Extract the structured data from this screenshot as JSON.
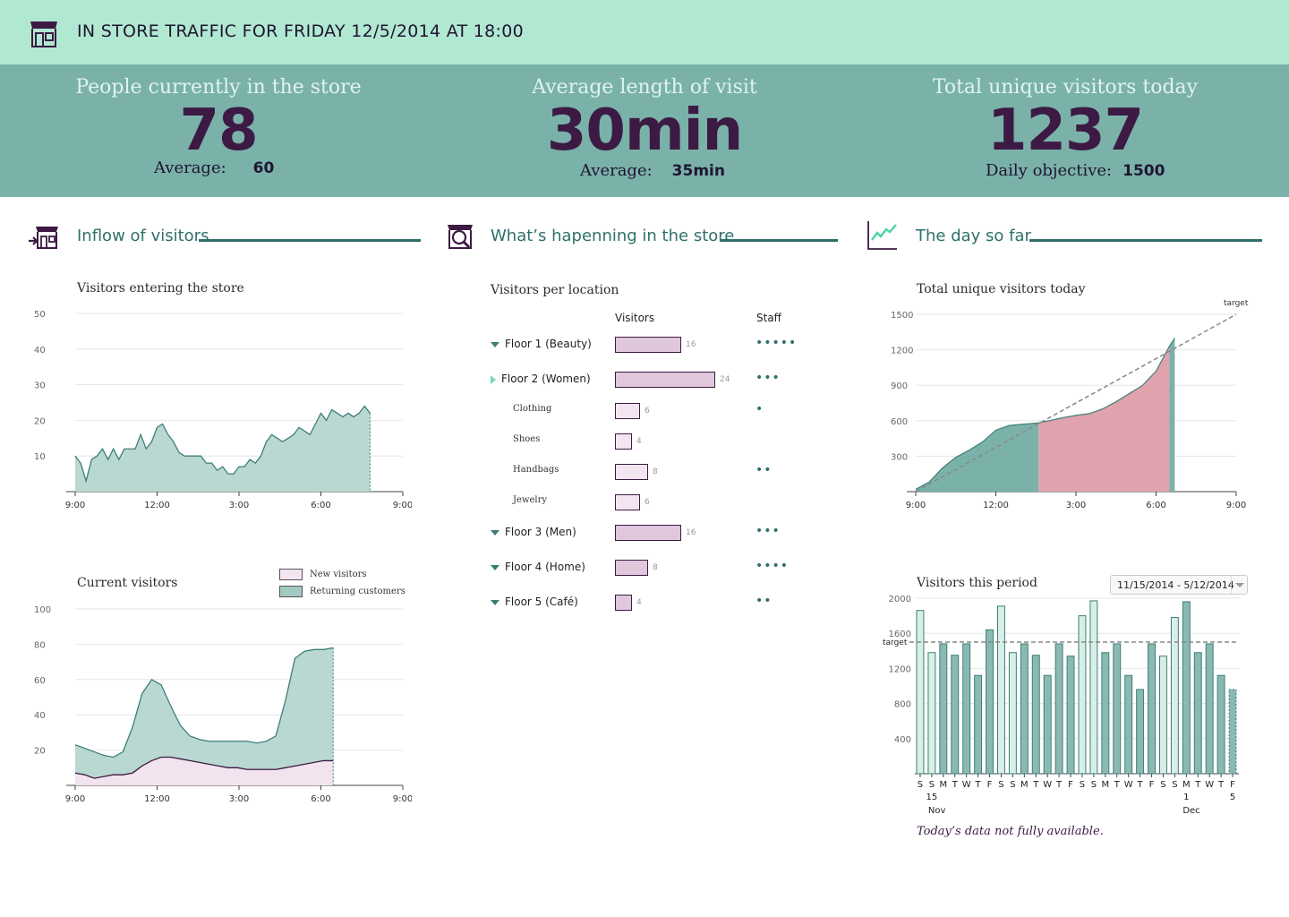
{
  "header": {
    "title": "IN STORE TRAFFIC FOR FRIDAY 12/5/2014 AT 18:00"
  },
  "kpis": [
    {
      "label": "People currently in the store",
      "value": "78",
      "sub_label": "Average:",
      "sub_value": "60"
    },
    {
      "label": "Average length of visit",
      "value": "30min",
      "sub_label": "Average:",
      "sub_value": "35min"
    },
    {
      "label": "Total unique visitors today",
      "value": "1237",
      "sub_label": "Daily objective:",
      "sub_value": "1500"
    }
  ],
  "sections": {
    "inflow": {
      "title": "Inflow of visitors"
    },
    "store": {
      "title": "What’s hapenning in the store"
    },
    "day": {
      "title": "The day so far"
    }
  },
  "locations": {
    "title": "Visitors per location",
    "col_visitors": "Visitors",
    "col_staff": "Staff",
    "rows": [
      {
        "label": "Floor 1 (Beauty)",
        "visitors": 16,
        "visitors_label": "16",
        "staff": 5,
        "level": "floor",
        "expanded": true
      },
      {
        "label": "Floor 2 (Women)",
        "visitors": 24,
        "visitors_label": "24",
        "staff": 3,
        "level": "floor",
        "expanded": false
      },
      {
        "label": "Clothing",
        "visitors": 6,
        "visitors_label": "6",
        "staff": 1,
        "level": "sub"
      },
      {
        "label": "Shoes",
        "visitors": 4,
        "visitors_label": "4",
        "staff": 0,
        "level": "sub"
      },
      {
        "label": "Handbags",
        "visitors": 8,
        "visitors_label": "8",
        "staff": 2,
        "level": "sub"
      },
      {
        "label": "Jewelry",
        "visitors": 6,
        "visitors_label": "6",
        "staff": 0,
        "level": "sub"
      },
      {
        "label": "Floor 3 (Men)",
        "visitors": 16,
        "visitors_label": "16",
        "staff": 3,
        "level": "floor",
        "expanded": true
      },
      {
        "label": "Floor 4 (Home)",
        "visitors": 8,
        "visitors_label": "8",
        "staff": 4,
        "level": "floor",
        "expanded": true
      },
      {
        "label": "Floor 5 (Café)",
        "visitors": 4,
        "visitors_label": "4",
        "staff": 2,
        "level": "floor",
        "expanded": true
      }
    ]
  },
  "period": {
    "date_range": "11/15/2014 - 5/12/2014",
    "note": "Today’s data not fully available."
  },
  "colors": {
    "teal": "#7ab2aa",
    "mint": "#b1e8d2",
    "plum": "#3c1a44",
    "pink": "#e0a3ad",
    "lilac": "#dfc7dc"
  },
  "chart_data": [
    {
      "type": "area",
      "title": "Visitors entering the store",
      "xlabel": "",
      "ylabel": "",
      "x_ticks": [
        "9:00",
        "12:00",
        "3:00",
        "6:00",
        "9:00"
      ],
      "y_ticks": [
        10,
        20,
        30,
        40,
        50
      ],
      "ylim": [
        0,
        50
      ],
      "x_hours": [
        9,
        21
      ],
      "grid": true,
      "series": [
        {
          "values": [
            10,
            8,
            3,
            9,
            10,
            12,
            9,
            12,
            9,
            12,
            12,
            12,
            16,
            12,
            14,
            18,
            19,
            16,
            14,
            11,
            10,
            10,
            10,
            10,
            8,
            8,
            6,
            7,
            5,
            5,
            7,
            7,
            9,
            8,
            10,
            14,
            16,
            15,
            14,
            15,
            16,
            18,
            17,
            16,
            19,
            22,
            20,
            23,
            22,
            21,
            22,
            21,
            22,
            24,
            22
          ]
        }
      ]
    },
    {
      "type": "area",
      "title": "Current visitors",
      "xlabel": "",
      "ylabel": "",
      "x_ticks": [
        "9:00",
        "12:00",
        "3:00",
        "6:00",
        "9:00"
      ],
      "y_ticks": [
        20,
        40,
        60,
        80,
        100
      ],
      "ylim": [
        0,
        100
      ],
      "x_hours": [
        9,
        21
      ],
      "grid": true,
      "legend": "top-right",
      "series": [
        {
          "name": "New visitors",
          "values": [
            7,
            6,
            4,
            5,
            6,
            6,
            7,
            11,
            14,
            16,
            16,
            15,
            14,
            13,
            12,
            11,
            10,
            10,
            9,
            9,
            9,
            9,
            10,
            11,
            12,
            13,
            14,
            14
          ]
        },
        {
          "name": "Returning customers",
          "values": [
            23,
            21,
            19,
            17,
            16,
            19,
            33,
            52,
            60,
            57,
            45,
            34,
            28,
            26,
            25,
            25,
            25,
            25,
            25,
            24,
            25,
            28,
            48,
            72,
            76,
            77,
            77,
            78
          ]
        }
      ]
    },
    {
      "type": "area",
      "title": "Total unique visitors today",
      "xlabel": "",
      "ylabel": "",
      "x_ticks": [
        "9:00",
        "12:00",
        "3:00",
        "6:00",
        "9:00"
      ],
      "y_ticks": [
        300,
        600,
        900,
        1200,
        1500
      ],
      "ylim": [
        0,
        1500
      ],
      "x_hours": [
        9,
        21
      ],
      "grid": true,
      "target_label": "target",
      "target": [
        [
          9,
          0
        ],
        [
          21,
          1500
        ]
      ],
      "series": [
        {
          "x": [
            9,
            9.5,
            10,
            10.5,
            11,
            11.5,
            12,
            12.5,
            13,
            13.5,
            13.6,
            14,
            14.5,
            15,
            15.5,
            16,
            16.5,
            17,
            17.5,
            18,
            18.5,
            18.7
          ],
          "values": [
            20,
            80,
            200,
            290,
            350,
            420,
            520,
            560,
            570,
            580,
            582,
            600,
            625,
            645,
            660,
            700,
            760,
            830,
            900,
            1020,
            1230,
            1300
          ]
        }
      ]
    },
    {
      "type": "bar",
      "title": "Visitors this period",
      "xlabel": "",
      "ylabel": "",
      "y_ticks": [
        400,
        800,
        1200,
        1600,
        2000
      ],
      "ylim": [
        0,
        2000
      ],
      "target_label": "target",
      "target": 1500,
      "grid": true,
      "categories": [
        "S",
        "S",
        "M",
        "T",
        "W",
        "T",
        "F",
        "S",
        "S",
        "M",
        "T",
        "W",
        "T",
        "F",
        "S",
        "S",
        "M",
        "T",
        "W",
        "T",
        "F",
        "S",
        "S",
        "M",
        "T",
        "W",
        "T",
        "F"
      ],
      "date_marks": [
        {
          "index": 1,
          "day": "15",
          "month": "Nov"
        },
        {
          "index": 23,
          "day": "1",
          "month": "Dec"
        },
        {
          "index": 27,
          "day": "5",
          "month": ""
        }
      ],
      "values": [
        1860,
        1380,
        1480,
        1350,
        1480,
        1120,
        1640,
        1910,
        1380,
        1480,
        1350,
        1120,
        1480,
        1340,
        1800,
        1970,
        1380,
        1480,
        1120,
        960,
        1480,
        1340,
        1780,
        1960,
        1380,
        1480,
        1120,
        960
      ],
      "weekend": [
        true,
        true,
        false,
        false,
        false,
        false,
        false,
        true,
        true,
        false,
        false,
        false,
        false,
        false,
        true,
        true,
        false,
        false,
        false,
        false,
        false,
        true,
        true,
        false,
        false,
        false,
        false,
        false
      ]
    }
  ]
}
